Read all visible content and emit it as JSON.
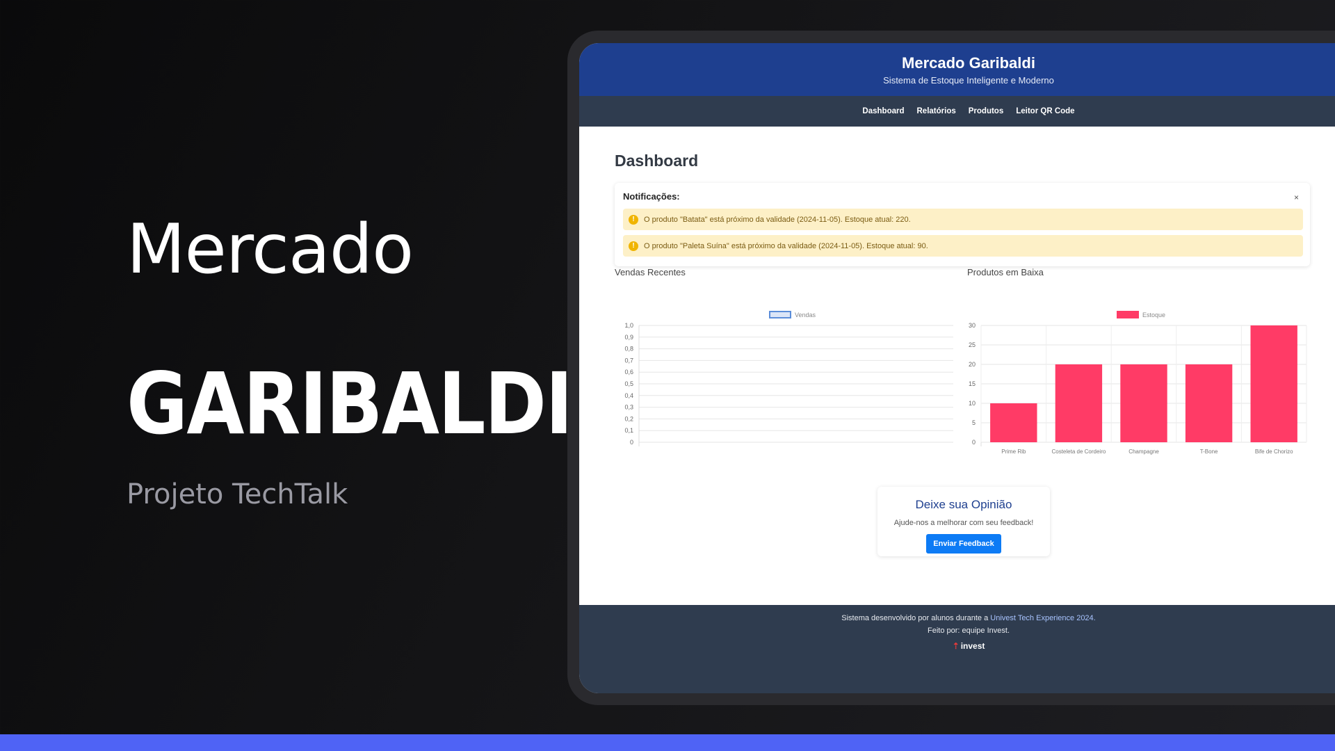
{
  "hero": {
    "line1": "Mercado",
    "line2": "GARIBALDI",
    "subtitle": "Projeto TechTalk"
  },
  "colors": {
    "accent_bar": "#4f63f5",
    "header_bg": "#1e3f8f",
    "nav_bg": "#2f3c4f",
    "bar_fill": "#ff3b66",
    "button_bg": "#0d7bf5",
    "warning_bg": "#fdf0c7"
  },
  "app": {
    "title": "Mercado Garibaldi",
    "subtitle": "Sistema de Estoque Inteligente e Moderno",
    "nav": [
      "Dashboard",
      "Relatórios",
      "Produtos",
      "Leitor QR Code"
    ],
    "page_title": "Dashboard",
    "notifications": {
      "heading": "Notificações:",
      "close": "×",
      "items": [
        "O produto \"Batata\" está próximo da validade (2024-11-05). Estoque atual: 220.",
        "O produto \"Paleta Suína\" está próximo da validade (2024-11-05). Estoque atual: 90."
      ],
      "icon": "warning-icon"
    },
    "feedback": {
      "title": "Deixe sua Opinião",
      "text": "Ajude-nos a melhorar com seu feedback!",
      "button": "Enviar Feedback"
    },
    "footer": {
      "line1_prefix": "Sistema desenvolvido por alunos durante a",
      "line1_link": "Univest Tech Experience 2024.",
      "line2": "Feito por: equipe Invest.",
      "logo": "invest"
    }
  },
  "chart_data": [
    {
      "type": "line",
      "title": "Vendas Recentes",
      "series": [
        {
          "name": "Vendas",
          "values": []
        }
      ],
      "ylim": [
        0,
        1.0
      ],
      "yticks": [
        "0",
        "0,1",
        "0,2",
        "0,3",
        "0,4",
        "0,5",
        "0,6",
        "0,7",
        "0,8",
        "0,9",
        "1,0"
      ],
      "legend": "top-center",
      "grid": true
    },
    {
      "type": "bar",
      "title": "Produtos em Baixa",
      "categories": [
        "Prime Rib",
        "Costeleta de Cordeiro",
        "Champagne",
        "T-Bone",
        "Bife de Chorizo"
      ],
      "series": [
        {
          "name": "Estoque",
          "values": [
            10,
            20,
            20,
            20,
            30
          ]
        }
      ],
      "ylim": [
        0,
        30
      ],
      "yticks": [
        "0",
        "5",
        "10",
        "15",
        "20",
        "25",
        "30"
      ],
      "legend": "top-center",
      "grid": true
    }
  ]
}
